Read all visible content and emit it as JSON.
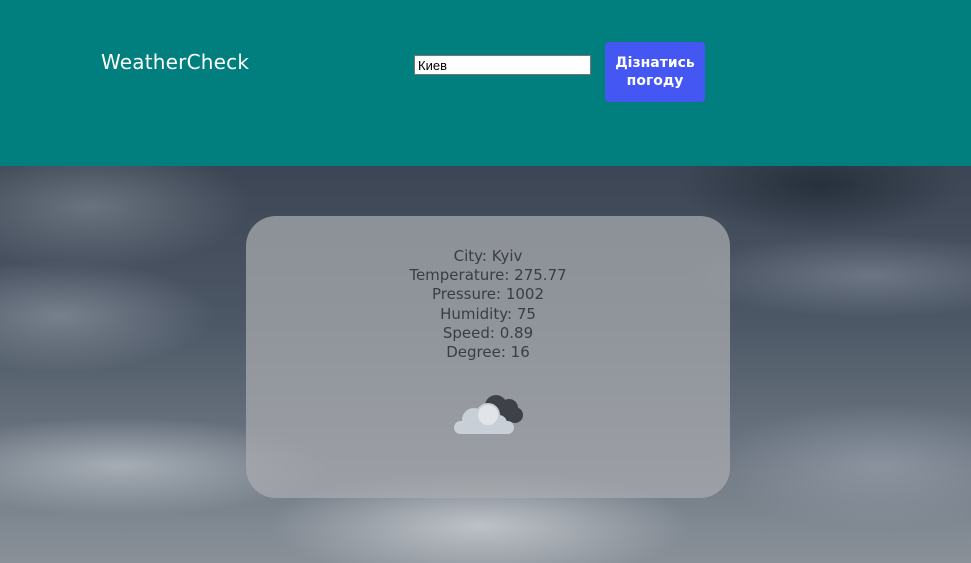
{
  "header": {
    "logo": "WeatherCheck",
    "search_value": "Киев",
    "button_label": "Дізнатись погоду",
    "background": "#007f7e",
    "button_color": "#4457f2"
  },
  "weather": {
    "city": "City: Kyiv",
    "temperature": "Temperature: 275.77",
    "pressure": "Pressure: 1002",
    "humidity": "Humidity: 75",
    "speed": "Speed: 0.89",
    "degree": "Degree: 16",
    "icon": "cloudy-icon"
  }
}
